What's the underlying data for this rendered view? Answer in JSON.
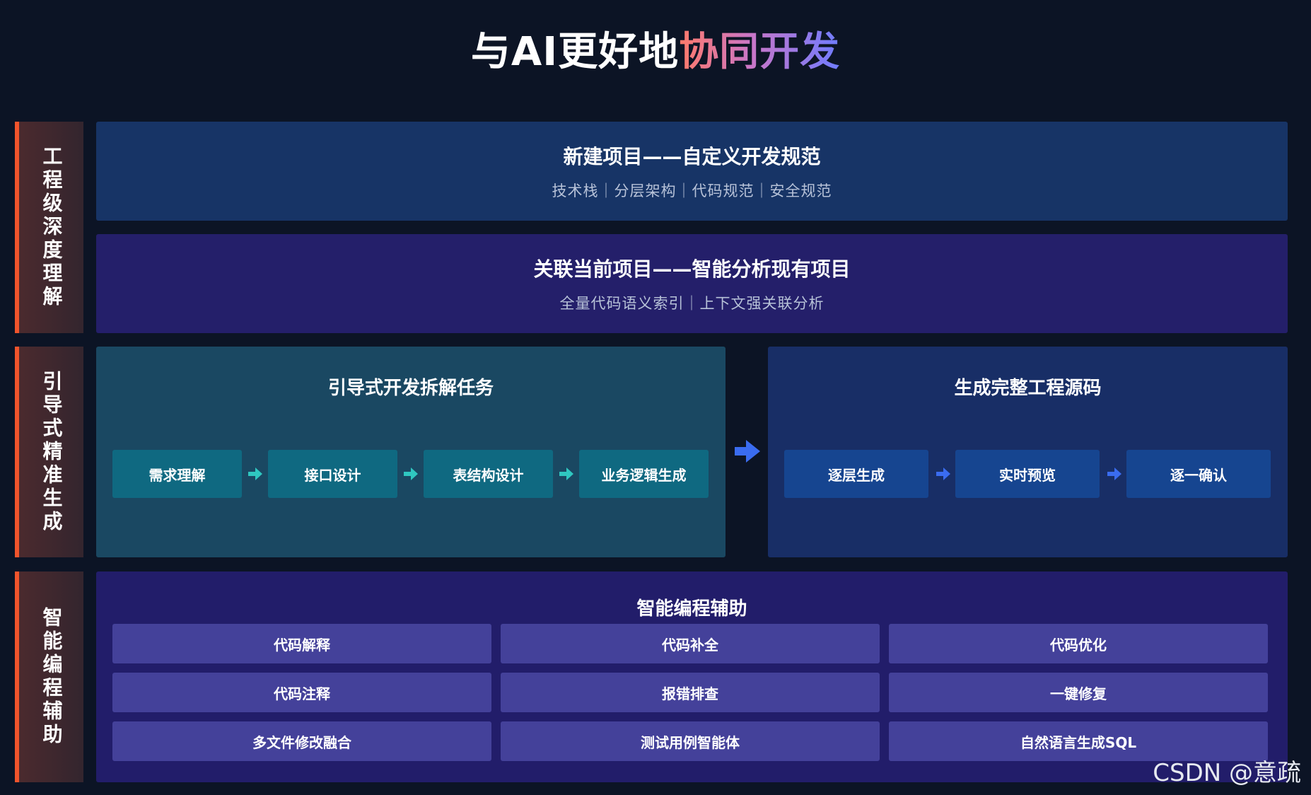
{
  "title": {
    "main": "与AI更好地",
    "highlight": "协同开发"
  },
  "sections": {
    "deep_understanding": "工程级深度理解",
    "guided_generation": "引导式精准生成",
    "smart_assist": "智能编程辅助"
  },
  "new_project": {
    "heading": "新建项目——自定义开发规范",
    "sub": "技术栈｜分层架构｜代码规范｜安全规范"
  },
  "link_project": {
    "heading": "关联当前项目——智能分析现有项目",
    "sub": "全量代码语义索引｜上下文强关联分析"
  },
  "guided": {
    "heading": "引导式开发拆解任务",
    "steps": [
      "需求理解",
      "接口设计",
      "表结构设计",
      "业务逻辑生成"
    ]
  },
  "generate": {
    "heading": "生成完整工程源码",
    "steps": [
      "逐层生成",
      "实时预览",
      "逐一确认"
    ]
  },
  "assist": {
    "heading": "智能编程辅助",
    "features": [
      [
        "代码解释",
        "代码补全",
        "代码优化"
      ],
      [
        "代码注释",
        "报错排查",
        "一键修复"
      ],
      [
        "多文件修改融合",
        "测试用例智能体",
        "自然语言生成SQL"
      ]
    ]
  },
  "watermark": "CSDN @意疏",
  "colors": {
    "accent_bar": "#f1542c",
    "teal_arrow": "#2fc7c0",
    "blue_arrow": "#3a6cf0"
  }
}
